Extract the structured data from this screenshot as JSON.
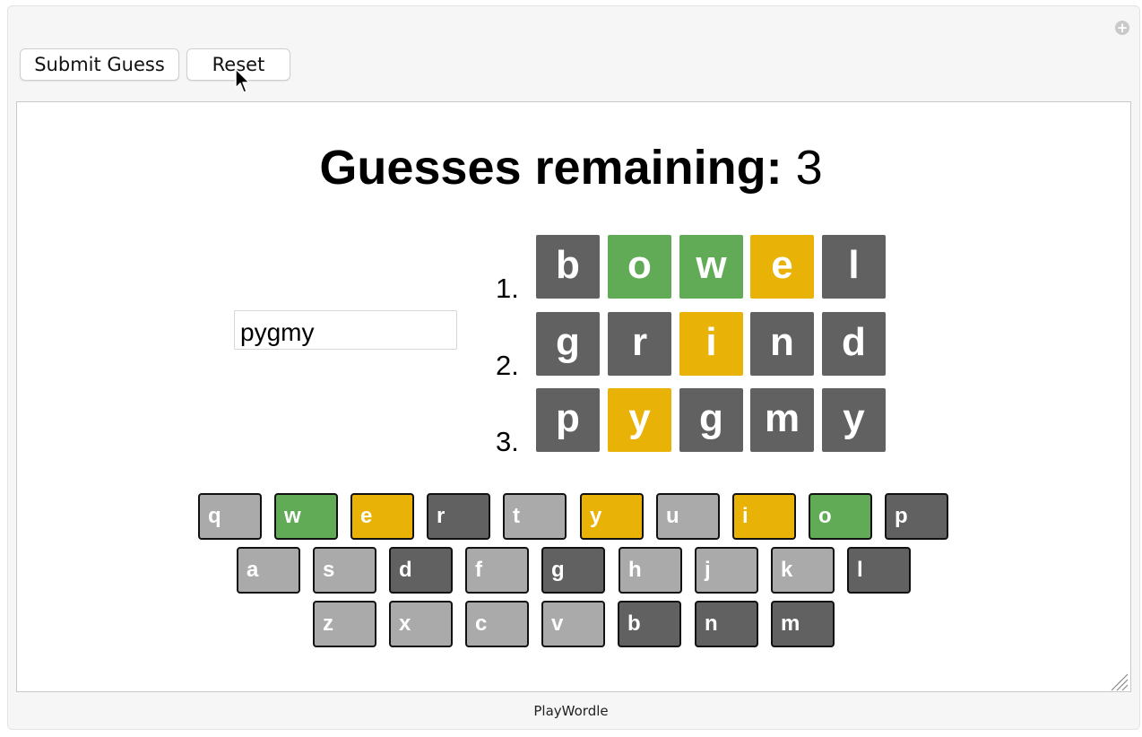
{
  "toolbar": {
    "submit_label": "Submit Guess",
    "reset_label": "Reset"
  },
  "close_icon": "plus-circle-icon",
  "heading": {
    "label": "Guesses remaining:",
    "count": "3"
  },
  "input": {
    "value": "pygmy"
  },
  "colors": {
    "green": "#62ab56",
    "yellow": "#e8b207",
    "dark": "#616161",
    "light": "#aaaaaa"
  },
  "guesses": [
    {
      "num": "1.",
      "tiles": [
        {
          "letter": "b",
          "state": "dark"
        },
        {
          "letter": "o",
          "state": "green"
        },
        {
          "letter": "w",
          "state": "green"
        },
        {
          "letter": "e",
          "state": "yellow"
        },
        {
          "letter": "l",
          "state": "dark"
        }
      ]
    },
    {
      "num": "2.",
      "tiles": [
        {
          "letter": "g",
          "state": "dark"
        },
        {
          "letter": "r",
          "state": "dark"
        },
        {
          "letter": "i",
          "state": "yellow"
        },
        {
          "letter": "n",
          "state": "dark"
        },
        {
          "letter": "d",
          "state": "dark"
        }
      ]
    },
    {
      "num": "3.",
      "tiles": [
        {
          "letter": "p",
          "state": "dark"
        },
        {
          "letter": "y",
          "state": "yellow"
        },
        {
          "letter": "g",
          "state": "dark"
        },
        {
          "letter": "m",
          "state": "dark"
        },
        {
          "letter": "y",
          "state": "dark"
        }
      ]
    }
  ],
  "keyboard": [
    [
      {
        "key": "q",
        "state": "light"
      },
      {
        "key": "w",
        "state": "green"
      },
      {
        "key": "e",
        "state": "yellow"
      },
      {
        "key": "r",
        "state": "dark"
      },
      {
        "key": "t",
        "state": "light"
      },
      {
        "key": "y",
        "state": "yellow"
      },
      {
        "key": "u",
        "state": "light"
      },
      {
        "key": "i",
        "state": "yellow"
      },
      {
        "key": "o",
        "state": "green"
      },
      {
        "key": "p",
        "state": "dark"
      }
    ],
    [
      {
        "key": "a",
        "state": "light"
      },
      {
        "key": "s",
        "state": "light"
      },
      {
        "key": "d",
        "state": "dark"
      },
      {
        "key": "f",
        "state": "light"
      },
      {
        "key": "g",
        "state": "dark"
      },
      {
        "key": "h",
        "state": "light"
      },
      {
        "key": "j",
        "state": "light"
      },
      {
        "key": "k",
        "state": "light"
      },
      {
        "key": "l",
        "state": "dark"
      }
    ],
    [
      {
        "key": "z",
        "state": "light"
      },
      {
        "key": "x",
        "state": "light"
      },
      {
        "key": "c",
        "state": "light"
      },
      {
        "key": "v",
        "state": "light"
      },
      {
        "key": "b",
        "state": "dark"
      },
      {
        "key": "n",
        "state": "dark"
      },
      {
        "key": "m",
        "state": "dark"
      }
    ]
  ],
  "footer": {
    "label": "PlayWordle"
  }
}
